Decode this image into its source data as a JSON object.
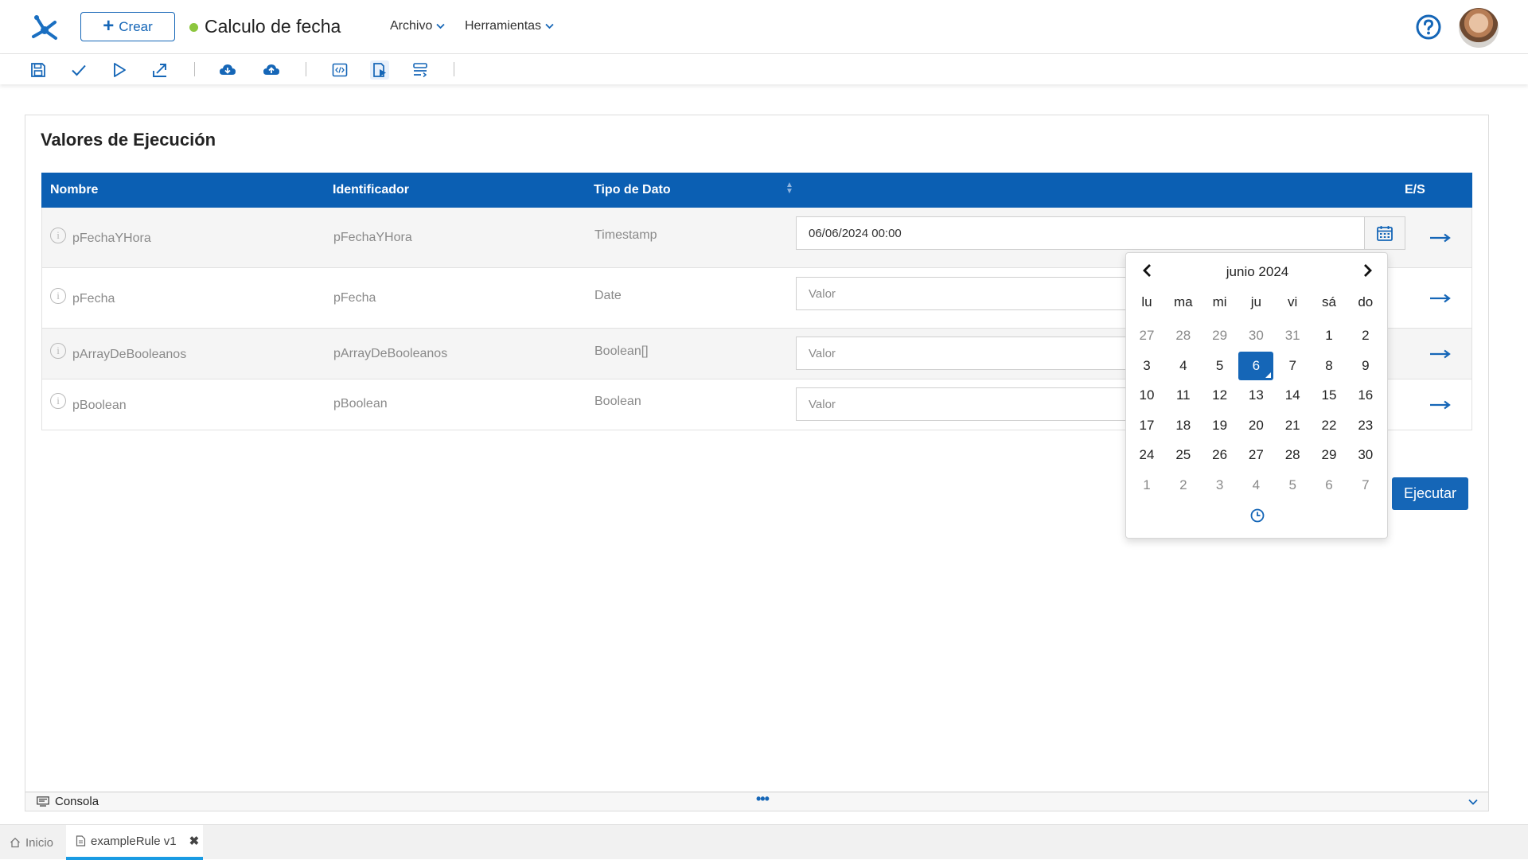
{
  "app": {
    "title": "Calculo de fecha",
    "create_label": "Crear",
    "status_color": "#8cc63e",
    "accent_color": "#1566b7",
    "menus": [
      {
        "label": "Archivo"
      },
      {
        "label": "Herramientas"
      }
    ]
  },
  "toolbar": {
    "icons": [
      "save-icon",
      "check-icon",
      "play-icon",
      "export-icon",
      "cloud-download-icon",
      "cloud-upload-icon",
      "code-icon",
      "run-test-icon",
      "format-icon"
    ]
  },
  "panel": {
    "title": "Valores de Ejecución",
    "columns": [
      "Nombre",
      "Identificador",
      "Tipo de Dato",
      "E/S"
    ],
    "rows": [
      {
        "name": "pFechaYHora",
        "identifier": "pFechaYHora",
        "type": "Timestamp",
        "value": "06/06/2024 00:00",
        "placeholder": ""
      },
      {
        "name": "pFecha",
        "identifier": "pFecha",
        "type": "Date",
        "value": "",
        "placeholder": "Valor"
      },
      {
        "name": "pArrayDeBooleanos",
        "identifier": "pArrayDeBooleanos",
        "type": "Boolean[]",
        "value": "",
        "placeholder": "Valor"
      },
      {
        "name": "pBoolean",
        "identifier": "pBoolean",
        "type": "Boolean",
        "value": "",
        "placeholder": "Valor"
      }
    ],
    "run_label": "Ejecutar"
  },
  "datepicker": {
    "title": "junio 2024",
    "weekdays": [
      "lu",
      "ma",
      "mi",
      "ju",
      "vi",
      "sá",
      "do"
    ],
    "weeks": [
      [
        "27",
        "28",
        "29",
        "30",
        "31",
        "1",
        "2"
      ],
      [
        "3",
        "4",
        "5",
        "6",
        "7",
        "8",
        "9"
      ],
      [
        "10",
        "11",
        "12",
        "13",
        "14",
        "15",
        "16"
      ],
      [
        "17",
        "18",
        "19",
        "20",
        "21",
        "22",
        "23"
      ],
      [
        "24",
        "25",
        "26",
        "27",
        "28",
        "29",
        "30"
      ],
      [
        "1",
        "2",
        "3",
        "4",
        "5",
        "6",
        "7"
      ]
    ],
    "selected_day": "6"
  },
  "console": {
    "label": "Consola",
    "dots": "•••"
  },
  "tabs": [
    {
      "label": "Inicio"
    },
    {
      "label": "exampleRule v1"
    }
  ]
}
